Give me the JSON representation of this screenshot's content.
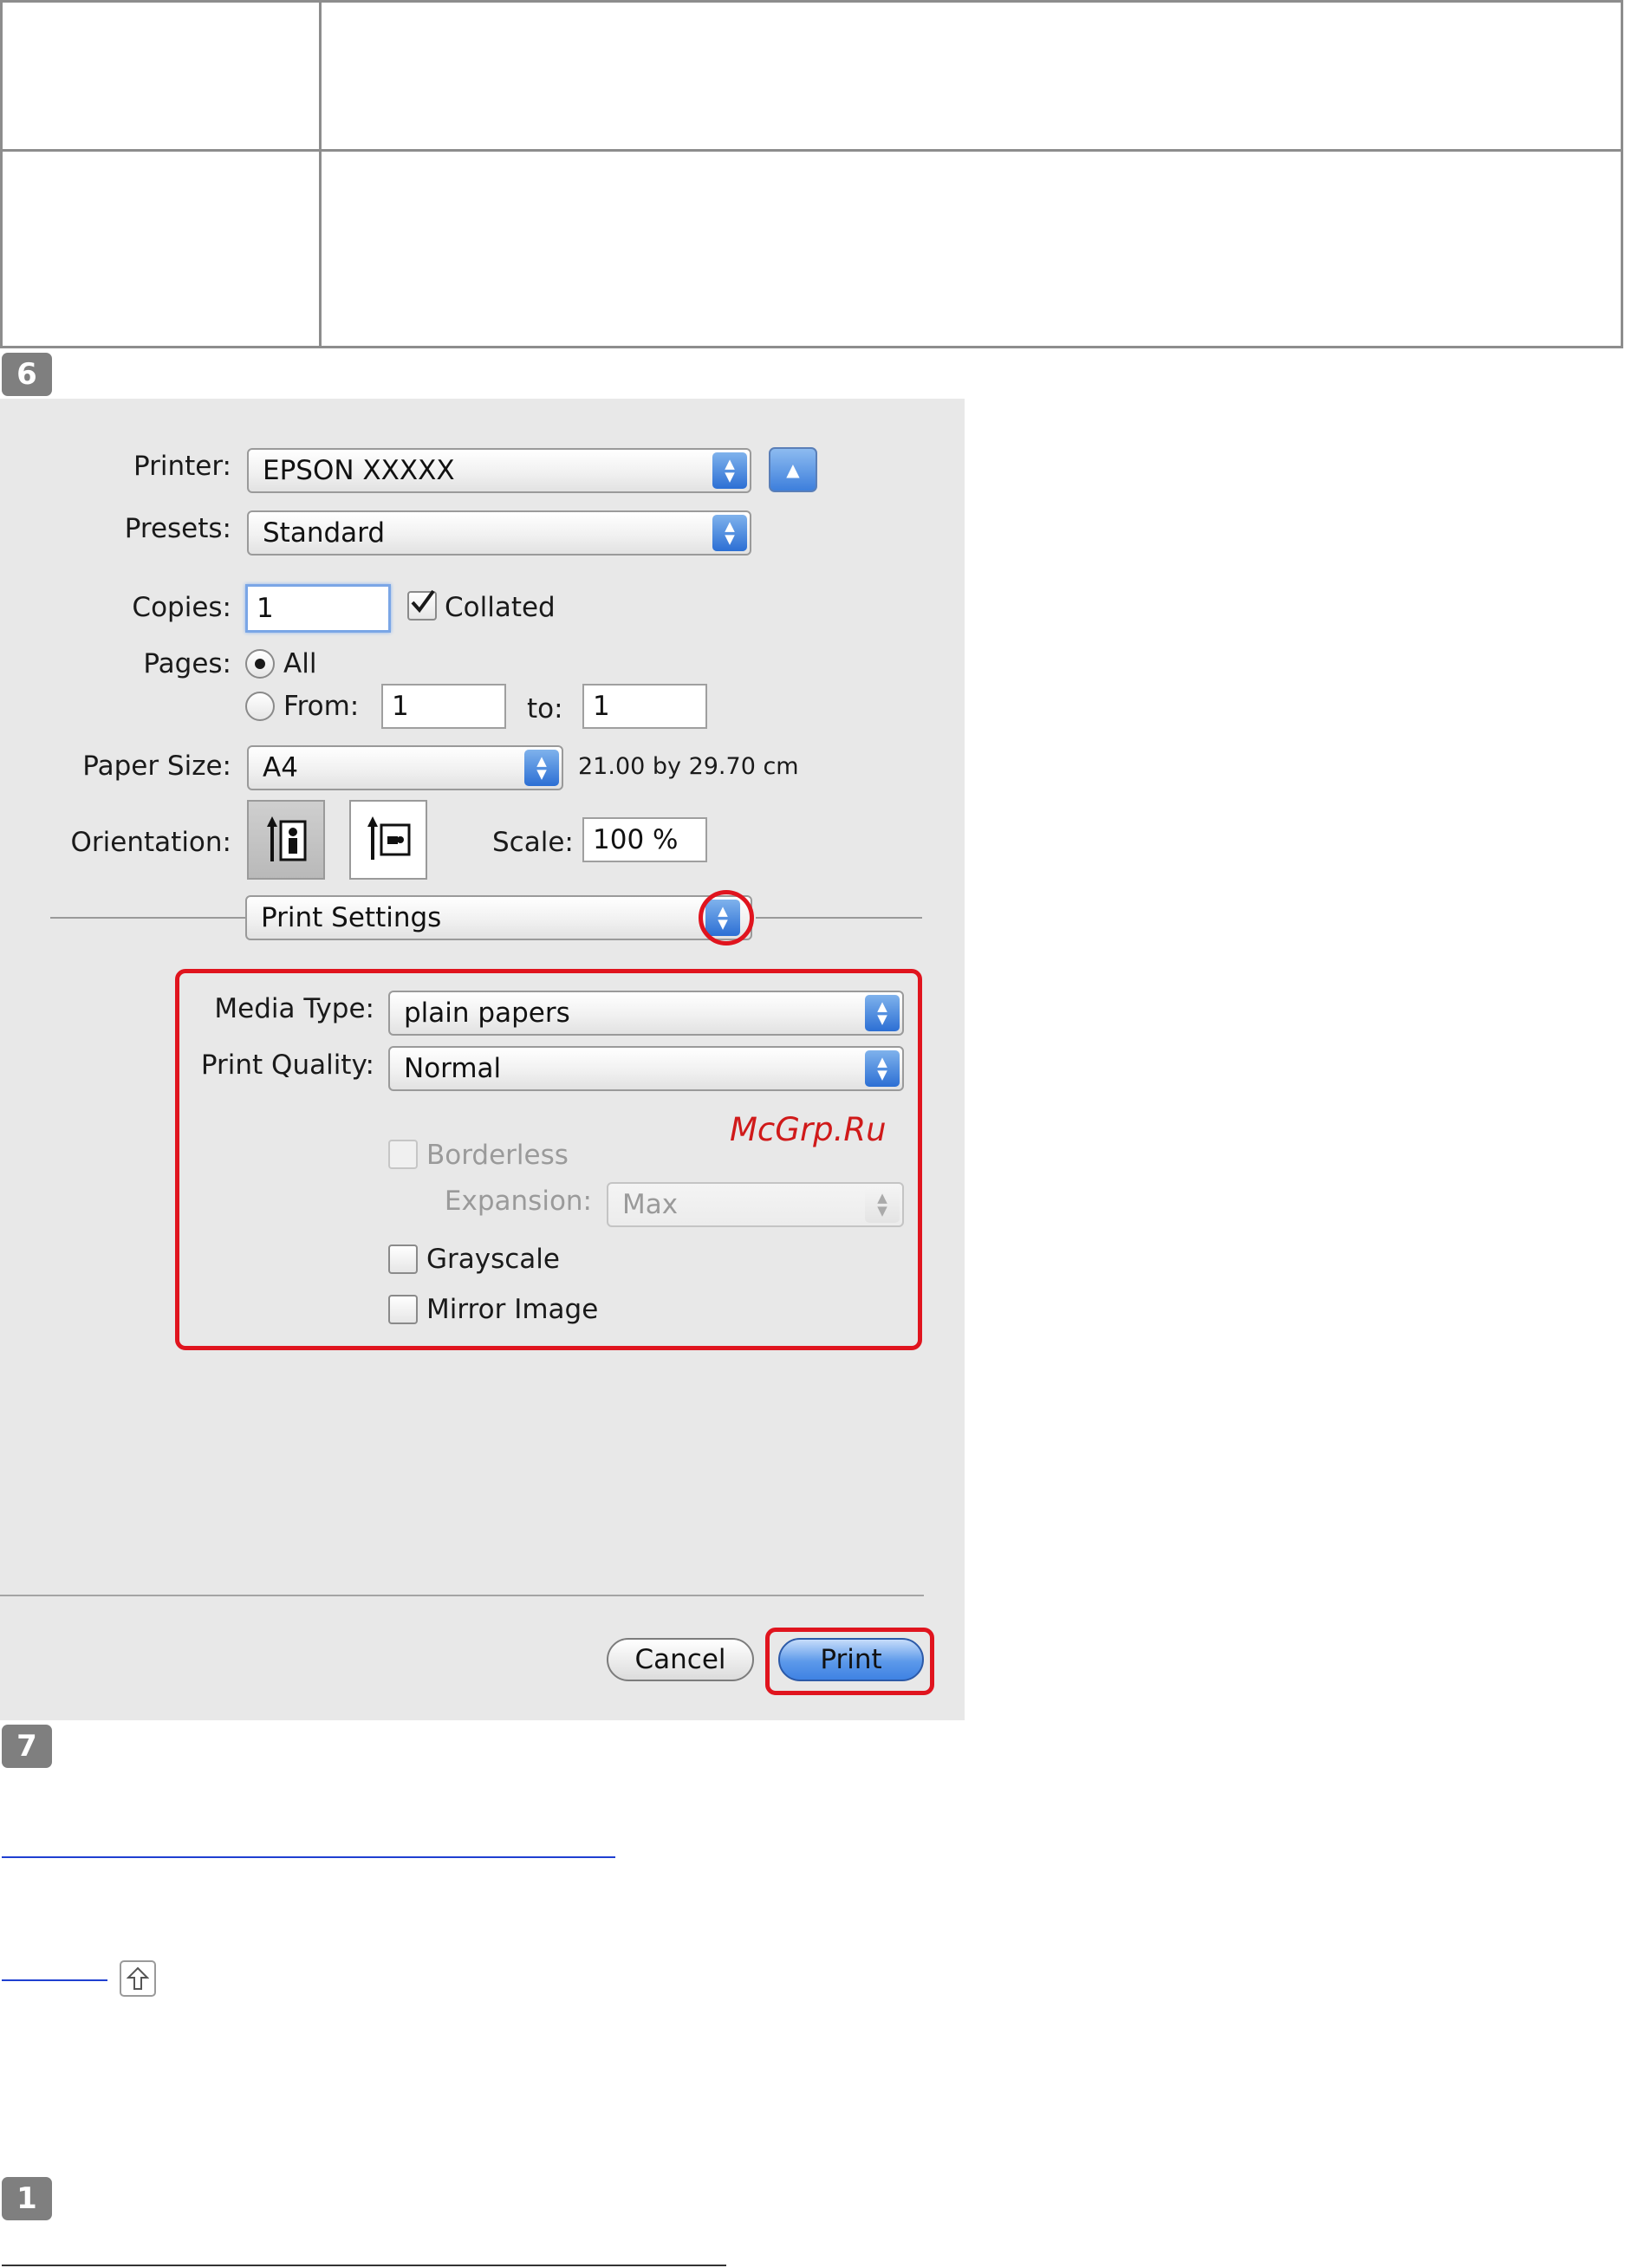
{
  "steps": {
    "step6": "6",
    "step7": "7",
    "step1": "1"
  },
  "dialog": {
    "printer_label": "Printer:",
    "printer_value": "EPSON XXXXX",
    "presets_label": "Presets:",
    "presets_value": "Standard",
    "copies_label": "Copies:",
    "copies_value": "1",
    "collated_label": "Collated",
    "pages_label": "Pages:",
    "pages_all": "All",
    "pages_from": "From:",
    "from_value": "1",
    "to_label": "to:",
    "to_value": "1",
    "paper_size_label": "Paper Size:",
    "paper_size_value": "A4",
    "paper_size_dims": "21.00 by 29.70 cm",
    "orientation_label": "Orientation:",
    "scale_label": "Scale:",
    "scale_value": "100 %",
    "section_value": "Print Settings",
    "media_type_label": "Media Type:",
    "media_type_value": "plain papers",
    "print_quality_label": "Print Quality:",
    "print_quality_value": "Normal",
    "borderless_label": "Borderless",
    "expansion_label": "Expansion:",
    "expansion_value": "Max",
    "grayscale_label": "Grayscale",
    "mirror_label": "Mirror Image",
    "watermark": "McGrp.Ru",
    "cancel_label": "Cancel",
    "print_label": "Print"
  },
  "colors": {
    "highlight": "#e0141e",
    "link": "#1f3fd1",
    "badge": "#7f7f7f"
  },
  "icons": [
    "popup-arrows-icon",
    "disclosure-triangle-icon",
    "checkmark-icon",
    "portrait-orientation-icon",
    "landscape-orientation-icon",
    "page-top-arrow-icon"
  ]
}
